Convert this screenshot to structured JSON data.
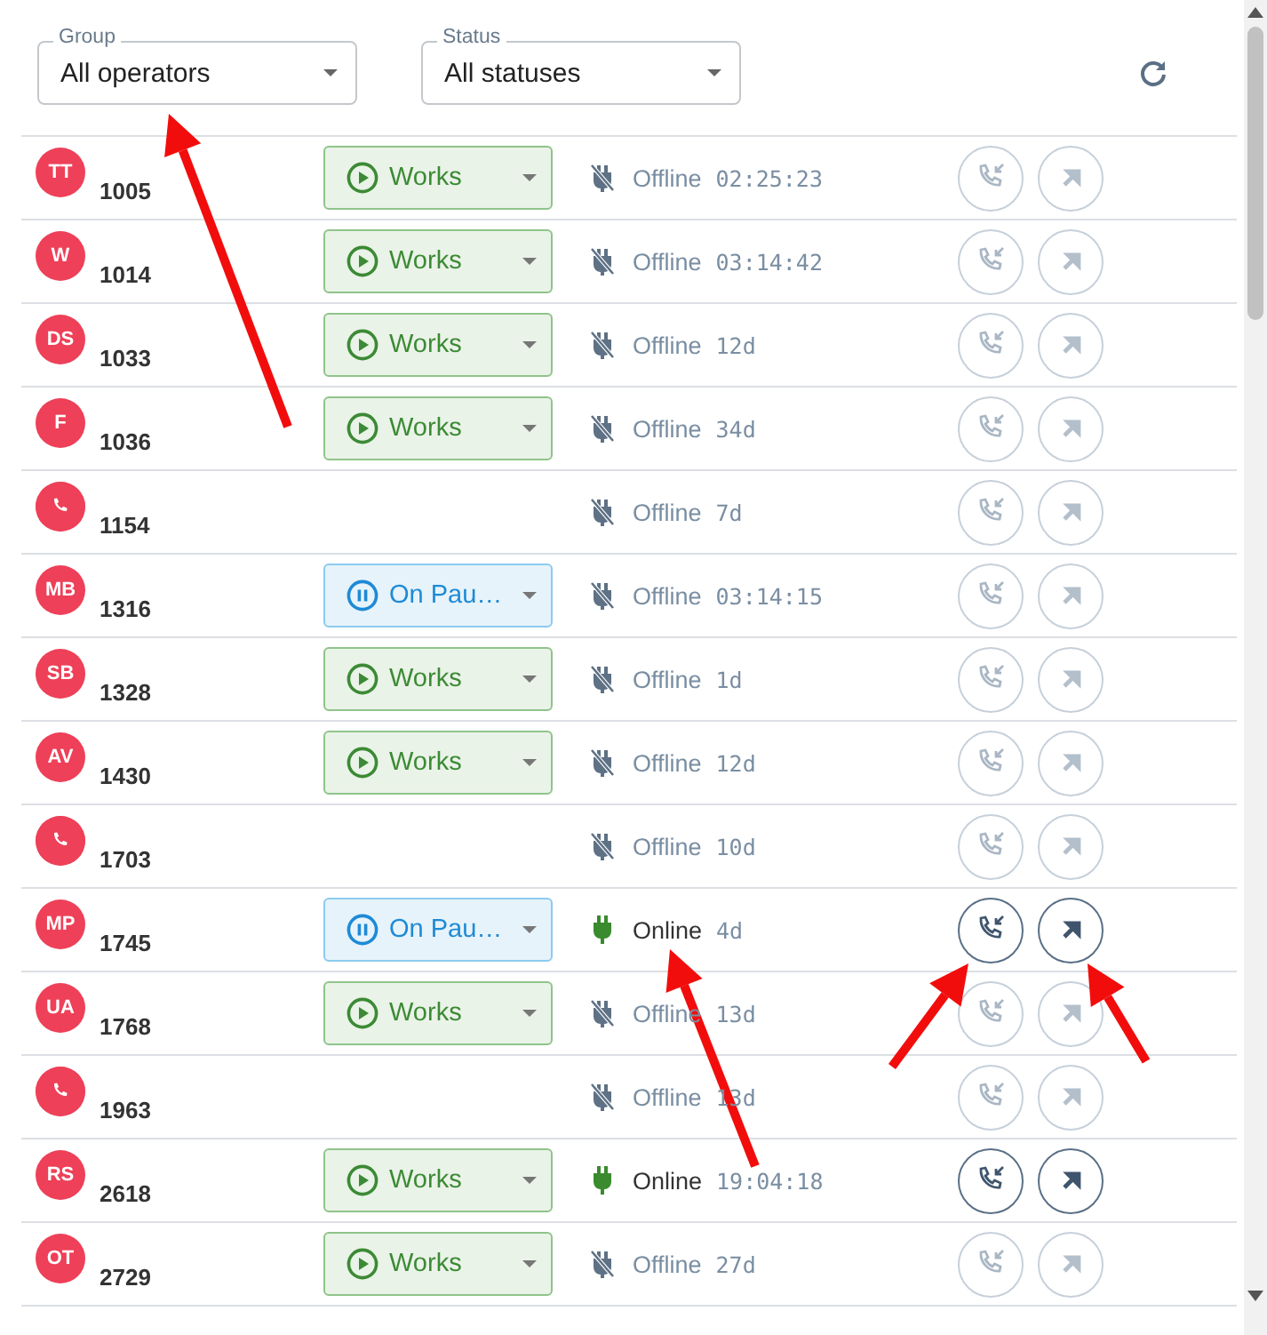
{
  "filters": [
    {
      "label": "Group",
      "value": "All operators"
    },
    {
      "label": "Status",
      "value": "All statuses"
    }
  ],
  "operators": [
    {
      "avatar": {
        "kind": "initials",
        "text": "TT"
      },
      "number": "1005",
      "status": {
        "kind": "works",
        "label": "Works"
      },
      "online": false,
      "connection": "Offline",
      "duration": "02:25:23"
    },
    {
      "avatar": {
        "kind": "initials",
        "text": "W"
      },
      "number": "1014",
      "status": {
        "kind": "works",
        "label": "Works"
      },
      "online": false,
      "connection": "Offline",
      "duration": "03:14:42"
    },
    {
      "avatar": {
        "kind": "initials",
        "text": "DS"
      },
      "number": "1033",
      "status": {
        "kind": "works",
        "label": "Works"
      },
      "online": false,
      "connection": "Offline",
      "duration": "12d"
    },
    {
      "avatar": {
        "kind": "initials",
        "text": "F"
      },
      "number": "1036",
      "status": {
        "kind": "works",
        "label": "Works"
      },
      "online": false,
      "connection": "Offline",
      "duration": "34d"
    },
    {
      "avatar": {
        "kind": "phone"
      },
      "number": "1154",
      "online": false,
      "connection": "Offline",
      "duration": "7d"
    },
    {
      "avatar": {
        "kind": "initials",
        "text": "MB"
      },
      "number": "1316",
      "status": {
        "kind": "pause",
        "label": "On Pau…"
      },
      "online": false,
      "connection": "Offline",
      "duration": "03:14:15"
    },
    {
      "avatar": {
        "kind": "initials",
        "text": "SB"
      },
      "number": "1328",
      "status": {
        "kind": "works",
        "label": "Works"
      },
      "online": false,
      "connection": "Offline",
      "duration": "1d"
    },
    {
      "avatar": {
        "kind": "initials",
        "text": "AV"
      },
      "number": "1430",
      "status": {
        "kind": "works",
        "label": "Works"
      },
      "online": false,
      "connection": "Offline",
      "duration": "12d"
    },
    {
      "avatar": {
        "kind": "phone"
      },
      "number": "1703",
      "online": false,
      "connection": "Offline",
      "duration": "10d"
    },
    {
      "avatar": {
        "kind": "initials",
        "text": "MP"
      },
      "number": "1745",
      "status": {
        "kind": "pause",
        "label": "On Pau…"
      },
      "online": true,
      "connection": "Online",
      "duration": "4d"
    },
    {
      "avatar": {
        "kind": "initials",
        "text": "UA"
      },
      "number": "1768",
      "status": {
        "kind": "works",
        "label": "Works"
      },
      "online": false,
      "connection": "Offline",
      "duration": "13d"
    },
    {
      "avatar": {
        "kind": "phone"
      },
      "number": "1963",
      "online": false,
      "connection": "Offline",
      "duration": "13d"
    },
    {
      "avatar": {
        "kind": "initials",
        "text": "RS"
      },
      "number": "2618",
      "status": {
        "kind": "works",
        "label": "Works"
      },
      "online": true,
      "connection": "Online",
      "duration": "19:04:18"
    },
    {
      "avatar": {
        "kind": "initials",
        "text": "OT"
      },
      "number": "2729",
      "status": {
        "kind": "works",
        "label": "Works"
      },
      "online": false,
      "connection": "Offline",
      "duration": "27d"
    }
  ]
}
